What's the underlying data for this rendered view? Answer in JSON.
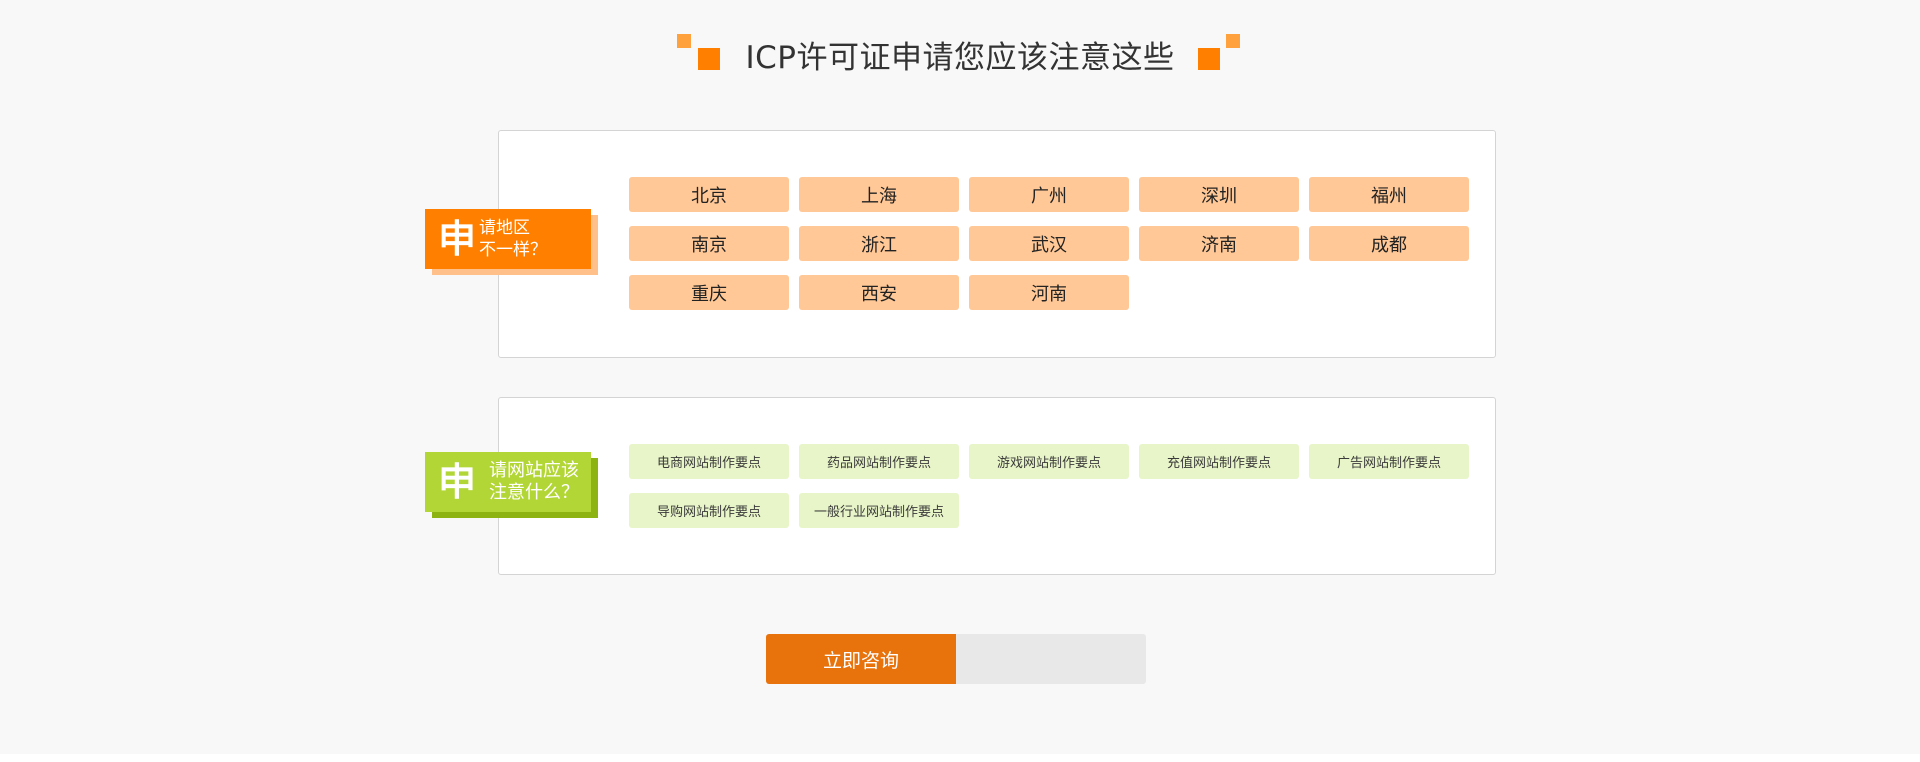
{
  "title": "ICP许可证申请您应该注意这些",
  "colors": {
    "accent": "#ff7f00",
    "green": "#b3d637",
    "region_chip": "#ffc896",
    "site_chip": "#e8f5c8",
    "cta": "#e8720c"
  },
  "region_section": {
    "badge_glyph": "申",
    "badge_line1": "请地区",
    "badge_line2": "不一样？",
    "items": [
      "北京",
      "上海",
      "广州",
      "深圳",
      "福州",
      "南京",
      "浙江",
      "武汉",
      "济南",
      "成都",
      "重庆",
      "西安",
      "河南"
    ]
  },
  "site_section": {
    "badge_glyph": "申",
    "badge_line1": "请网站应该",
    "badge_line2": "注意什么？",
    "items": [
      "电商网站制作要点",
      "药品网站制作要点",
      "游戏网站制作要点",
      "充值网站制作要点",
      "广告网站制作要点",
      "导购网站制作要点",
      "一般行业网站制作要点"
    ]
  },
  "cta": {
    "label": "立即咨询"
  }
}
